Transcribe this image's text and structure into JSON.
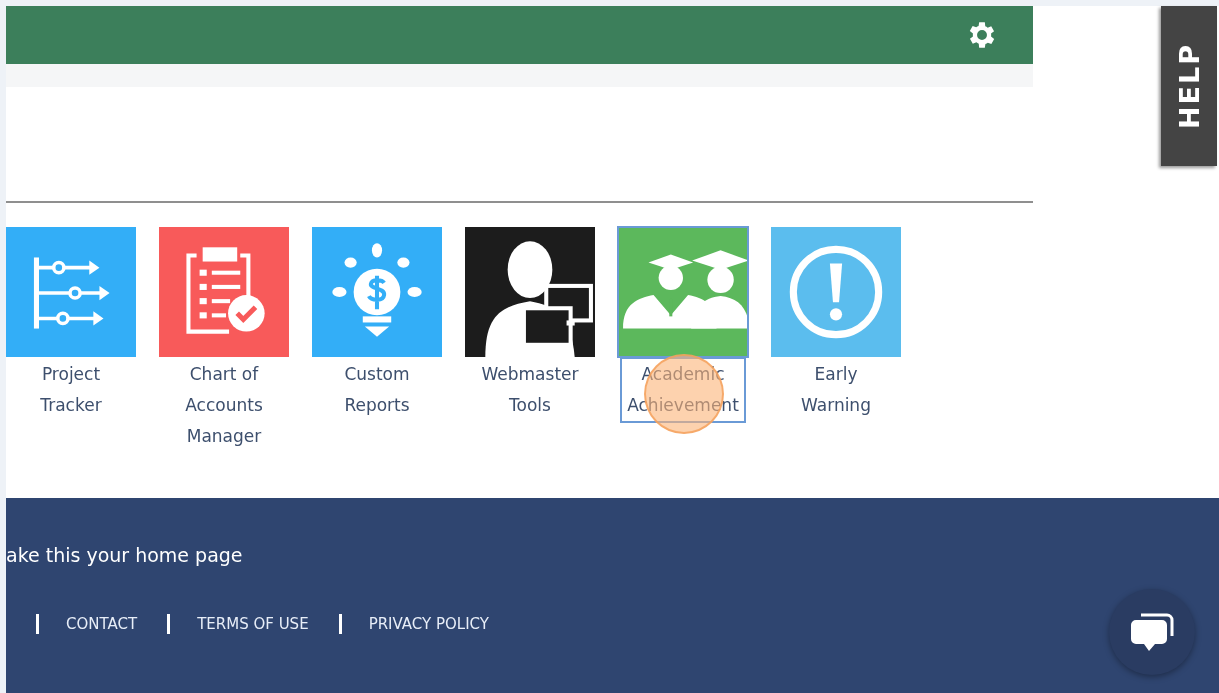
{
  "help_tab": {
    "label": "HELP"
  },
  "tiles": [
    {
      "label": "Project Tracker",
      "kind": "tracker",
      "color": "#33aef7",
      "selected": false
    },
    {
      "label": "Chart of Accounts Manager",
      "kind": "clipboard",
      "color": "#f85a5a",
      "selected": false
    },
    {
      "label": "Custom Reports",
      "kind": "bulb",
      "color": "#33aef7",
      "selected": false
    },
    {
      "label": "Webmaster Tools",
      "kind": "webmaster",
      "color": "#1c1c1c",
      "selected": false
    },
    {
      "label": "Academic Achievement",
      "kind": "graduates",
      "color": "#5cb85c",
      "selected": true
    },
    {
      "label": "Early Warning",
      "kind": "warning",
      "color": "#5bbdee",
      "selected": false
    }
  ],
  "footer": {
    "home_page_link": "ake this your home page",
    "links": [
      "CONTACT",
      "TERMS OF USE",
      "PRIVACY POLICY"
    ]
  }
}
